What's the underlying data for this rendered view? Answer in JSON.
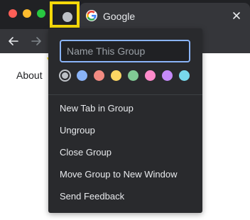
{
  "window": {
    "tab_title": "Google",
    "group_chip_color": "#bdc1c6"
  },
  "toolbar": {
    "back_icon": "arrow-left-icon",
    "forward_icon": "arrow-right-icon"
  },
  "page": {
    "about_link": "About"
  },
  "group_menu": {
    "name_placeholder": "Name This Group",
    "name_value": "",
    "colors": [
      "#bdc1c6",
      "#8ab4f8",
      "#f28b82",
      "#fdd663",
      "#81c995",
      "#ff8bcb",
      "#c58af9",
      "#78d9ec"
    ],
    "selected_color_index": 0,
    "items": [
      {
        "label": "New Tab in Group"
      },
      {
        "label": "Ungroup"
      },
      {
        "label": "Close Group"
      },
      {
        "label": "Move Group to New Window"
      },
      {
        "label": "Send Feedback"
      }
    ]
  },
  "annotation": {
    "highlight_color": "#f5d90a"
  }
}
